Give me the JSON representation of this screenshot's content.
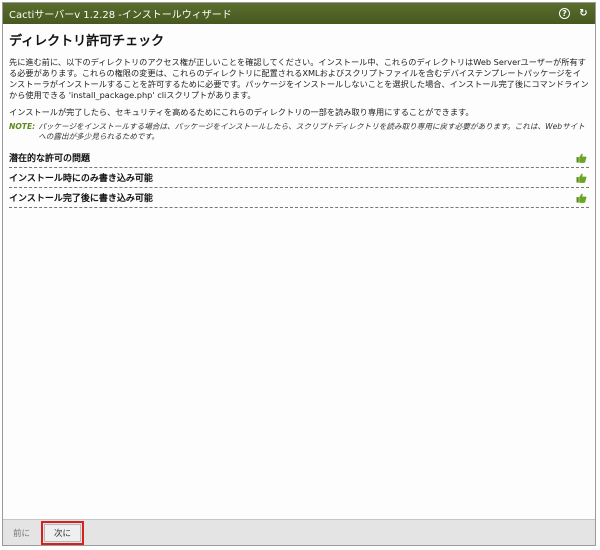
{
  "window": {
    "title": "Cactiサーバーv 1.2.28 -インストールウィザード"
  },
  "page": {
    "heading": "ディレクトリ許可チェック",
    "para1": "先に進む前に、以下のディレクトリのアクセス権が正しいことを確認してください。インストール中、これらのディレクトリはWeb Serverユーザーが所有する必要があります。これらの権限の変更は、これらのディレクトリに配置されるXMLおよびスクリプトファイルを含むデバイステンプレートパッケージをインストーラがインストールすることを許可するために必要です。パッケージをインストールしないことを選択した場合、インストール完了後にコマンドラインから使用できる 'install_package.php' cliスクリプトがあります。",
    "para2": "インストールが完了したら、セキュリティを高めるためにこれらのディレクトリの一部を読み取り専用にすることができます。",
    "note_label": "NOTE:",
    "note_text": "パッケージをインストールする場合は、パッケージをインストールしたら、スクリプトディレクトリを読み取り専用に戻す必要があります。これは、Webサイトへの露出が多少見られるためです。",
    "permission_rows": [
      {
        "label": "潜在的な許可の問題",
        "status_icon": "thumbs-up-icon"
      },
      {
        "label": "インストール時にのみ書き込み可能",
        "status_icon": "thumbs-up-icon"
      },
      {
        "label": "インストール完了後に書き込み可能",
        "status_icon": "thumbs-up-icon"
      }
    ]
  },
  "footer": {
    "prev_label": "前に",
    "next_label": "次に"
  },
  "colors": {
    "titlebar": "#4f6326",
    "accent_green": "#5c8a1e",
    "highlight_red": "#d32020"
  }
}
